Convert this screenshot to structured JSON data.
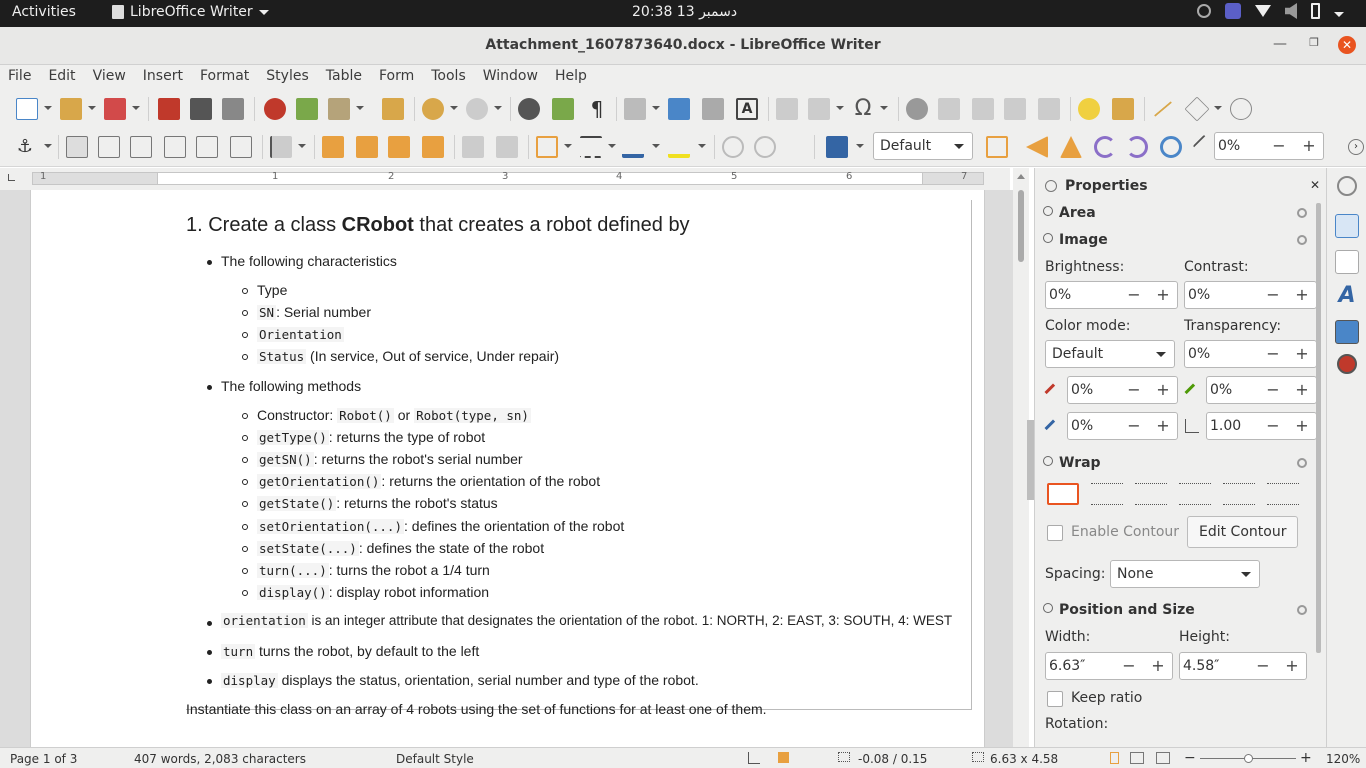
{
  "topbar": {
    "activities": "Activities",
    "app_name": "LibreOffice Writer",
    "clock": "20:38  13 دسمبر"
  },
  "window": {
    "title": "Attachment_1607873640.docx - LibreOffice Writer"
  },
  "menu": [
    "File",
    "Edit",
    "View",
    "Insert",
    "Format",
    "Styles",
    "Table",
    "Form",
    "Tools",
    "Window",
    "Help"
  ],
  "toolbar2": {
    "frame_style": "Default",
    "transparency": "0%"
  },
  "ruler": {
    "numbers": [
      "1",
      "1",
      "2",
      "3",
      "4",
      "5",
      "6",
      "7"
    ]
  },
  "document": {
    "heading_prefix": "1. Create a class ",
    "heading_bold": "CRobot",
    "heading_suffix": " that creates a robot defined by",
    "characteristics_title": "The following characteristics",
    "characteristics": [
      {
        "code": "",
        "text": "Type"
      },
      {
        "code": "SN",
        "text": ": Serial number"
      },
      {
        "code": "Orientation",
        "text": ""
      },
      {
        "code": "Status",
        "text": " (In service, Out of service, Under repair)"
      }
    ],
    "methods_title": "The following methods",
    "constructor_label": "Constructor: ",
    "constructor_code1": "Robot()",
    "constructor_or": " or ",
    "constructor_code2": "Robot(type, sn)",
    "methods": [
      {
        "code": "getType()",
        "text": ": returns the type of robot"
      },
      {
        "code": "getSN()",
        "text": ": returns the robot's serial number"
      },
      {
        "code": "getOrientation()",
        "text": ": returns the orientation of the robot"
      },
      {
        "code": "getState()",
        "text": ": returns the robot's status"
      },
      {
        "code": "setOrientation(...)",
        "text": ": defines the orientation of the robot"
      },
      {
        "code": "setState(...)",
        "text": ": defines the state of the robot"
      },
      {
        "code": "turn(...)",
        "text": ": turns the robot a 1/4 turn"
      },
      {
        "code": "display()",
        "text": ": display robot information"
      }
    ],
    "notes": [
      {
        "code": "orientation",
        "text": " is an integer attribute that designates the orientation of the robot. 1: NORTH, 2: EAST, 3: SOUTH, 4: WEST"
      },
      {
        "code": "turn",
        "text": " turns the robot, by default to the left"
      },
      {
        "code": "display",
        "text": " displays the status, orientation, serial number and type of the robot."
      }
    ],
    "final_line": "Instantiate this class on an array of 4 robots using the set of functions for at least one of them."
  },
  "sidebar": {
    "title": "Properties",
    "area": "Area",
    "image": "Image",
    "brightness_label": "Brightness:",
    "brightness": "0%",
    "contrast_label": "Contrast:",
    "contrast": "0%",
    "color_mode_label": "Color mode:",
    "color_mode": "Default",
    "transparency_label": "Transparency:",
    "transparency": "0%",
    "red": "0%",
    "green": "0%",
    "blue": "0%",
    "gamma": "1.00",
    "wrap": "Wrap",
    "enable_contour": "Enable Contour",
    "edit_contour": "Edit Contour",
    "spacing_label": "Spacing:",
    "spacing": "None",
    "position_size": "Position and Size",
    "width_label": "Width:",
    "width": "6.63″",
    "height_label": "Height:",
    "height": "4.58″",
    "keep_ratio": "Keep ratio",
    "rotation_label": "Rotation:"
  },
  "status": {
    "page": "Page 1 of 3",
    "words": "407 words, 2,083 characters",
    "style": "Default Style",
    "position": "-0.08 / 0.15",
    "size": "6.63 x 4.58",
    "zoom": "120%"
  },
  "colors": {
    "accent": "#e95420",
    "topbar": "#1d1d1d",
    "chrome": "#efefee"
  }
}
